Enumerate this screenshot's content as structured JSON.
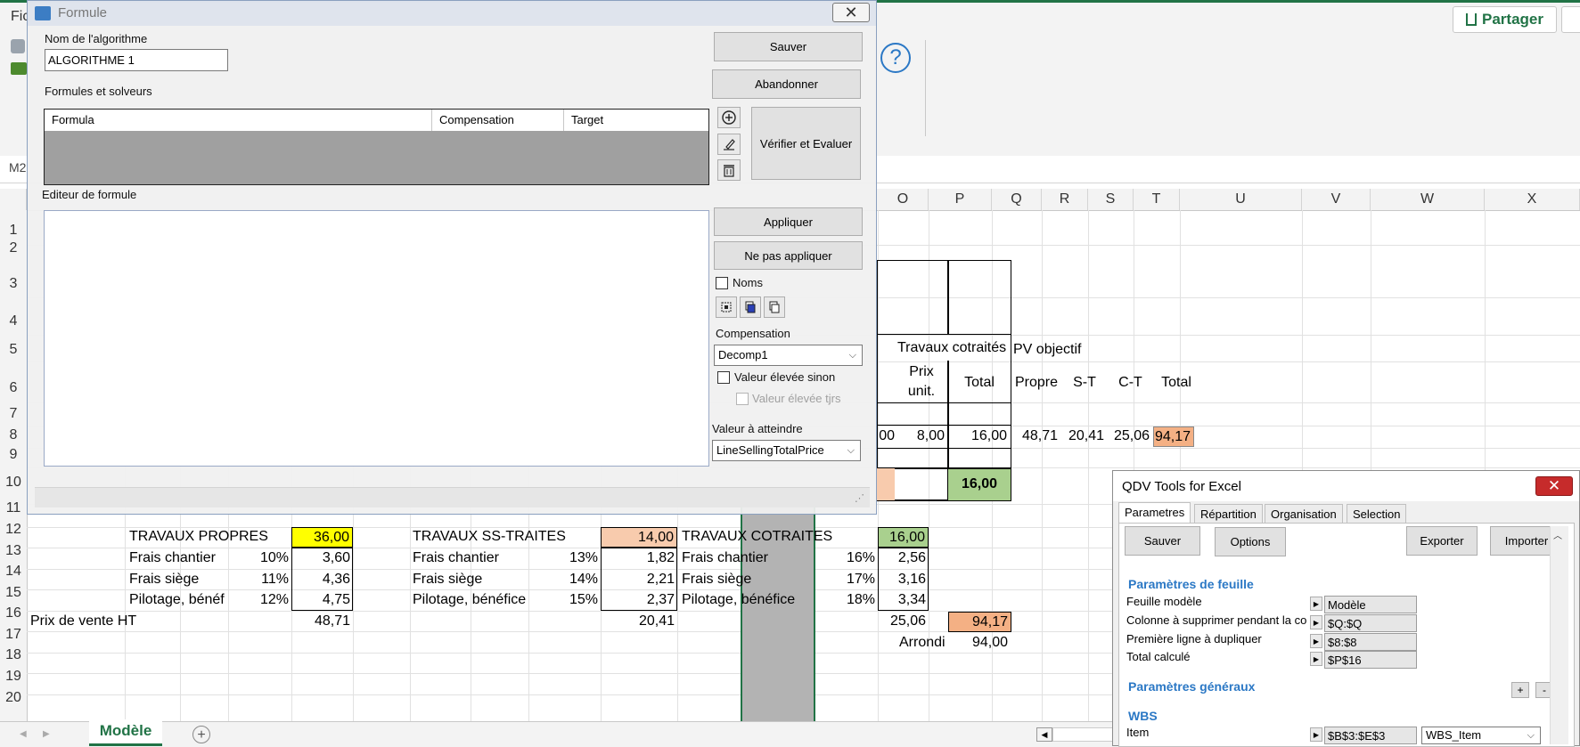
{
  "excel": {
    "menu_partial": "Fic",
    "namebox_partial": "M2",
    "share_label": "Partager",
    "help_glyph": "?",
    "columns": [
      "O",
      "P",
      "Q",
      "R",
      "S",
      "T",
      "U",
      "V",
      "W",
      "X"
    ],
    "rows": [
      "1",
      "2",
      "3",
      "4",
      "5",
      "6",
      "7",
      "8",
      "9",
      "10",
      "11",
      "12",
      "13",
      "14",
      "15",
      "16",
      "17",
      "18",
      "19",
      "20"
    ],
    "cells": {
      "travaux_cotraites_header": "Travaux cotraités",
      "pv_objectif": "PV objectif",
      "prix_unit": "Prix unit.",
      "total_o": "Total",
      "propre": "Propre",
      "st": "S-T",
      "ct": "C-T",
      "total_t": "Total",
      "r8_n": "00",
      "r8_o": "8,00",
      "r8_p": "16,00",
      "r8_q": "48,71",
      "r8_r": "20,41",
      "r8_s": "25,06",
      "r8_t": "94,17",
      "r10_p": "16,00",
      "travaux_propres": "TRAVAUX PROPRES",
      "travaux_propres_val": "36,00",
      "travaux_ss": "TRAVAUX SS-TRAITES",
      "travaux_ss_val": "14,00",
      "travaux_cot": "TRAVAUX COTRAITES",
      "travaux_cot_val": "16,00",
      "frais_chantier": "Frais chantier",
      "frais_siege": "Frais siège",
      "pilotage_short": "Pilotage, bénéf",
      "pilotage_long": "Pilotage, bénéfice",
      "pct_10": "10%",
      "val_360": "3,60",
      "pct_11": "11%",
      "val_436": "4,36",
      "pct_12": "12%",
      "val_475": "4,75",
      "pct_13": "13%",
      "val_182": "1,82",
      "pct_14": "14%",
      "val_221": "2,21",
      "pct_15": "15%",
      "val_237": "2,37",
      "pct_16": "16%",
      "val_256": "2,56",
      "pct_17": "17%",
      "val_316": "3,16",
      "pct_18": "18%",
      "val_334": "3,34",
      "prix_vente": "Prix de vente HT",
      "pv_propre": "48,71",
      "pv_ss": "20,41",
      "pv_cot": "25,06",
      "pv_total": "94,17",
      "arrondi": "Arrondi",
      "arrondi_val": "94,00"
    },
    "sheet_tab": "Modèle",
    "add_sheet": "+"
  },
  "formule": {
    "title": "Formule",
    "close": "✕",
    "nom_label": "Nom de l'algorithme",
    "nom_value": "ALGORITHME 1",
    "sauver": "Sauver",
    "abandonner": "Abandonner",
    "formules_label": "Formules et solveurs",
    "grid_headers": [
      "Formula",
      "Compensation",
      "Target"
    ],
    "verifier": "Vérifier et Evaluer",
    "editeur_label": "Editeur de formule",
    "appliquer": "Appliquer",
    "ne_pas_appliquer": "Ne pas appliquer",
    "noms": "Noms",
    "compensation_label": "Compensation",
    "compensation_value": "Decomp1",
    "valeur_elevee_sinon": "Valeur élevée sinon",
    "valeur_elevee_tjrs": "Valeur élevée tjrs",
    "valeur_atteindre_label": "Valeur à atteindre",
    "valeur_atteindre_value": "LineSellingTotalPrice"
  },
  "qdv": {
    "title": "QDV Tools for Excel",
    "close": "✕",
    "tabs": [
      "Parametres",
      "Répartition",
      "Organisation",
      "Selection"
    ],
    "sauver": "Sauver",
    "options": "Options",
    "exporter": "Exporter",
    "importer": "Importer",
    "section_feuille": "Paramètres de feuille",
    "feuille_modele_label": "Feuille modèle",
    "feuille_modele_value": "Modèle",
    "colonne_label": "Colonne à supprimer pendant la co",
    "colonne_value": "$Q:$Q",
    "premiere_label": "Première ligne à dupliquer",
    "premiere_value": "$8:$8",
    "total_label": "Total calculé",
    "total_value": "$P$16",
    "section_generaux": "Paramètres généraux",
    "plus": "+",
    "minus": "-",
    "section_wbs": "WBS",
    "item_label": "Item",
    "item_value": "$B$3:$E$3",
    "item_select": "WBS_Item"
  },
  "colors": {
    "excel_green": "#217346",
    "yellow": "#ffff00",
    "salmon": "#f8cbad",
    "green_fill": "#a9d08e",
    "orange_fill": "#f4b084",
    "qdv_blue": "#2b78c5",
    "close_red": "#c62b2b"
  }
}
